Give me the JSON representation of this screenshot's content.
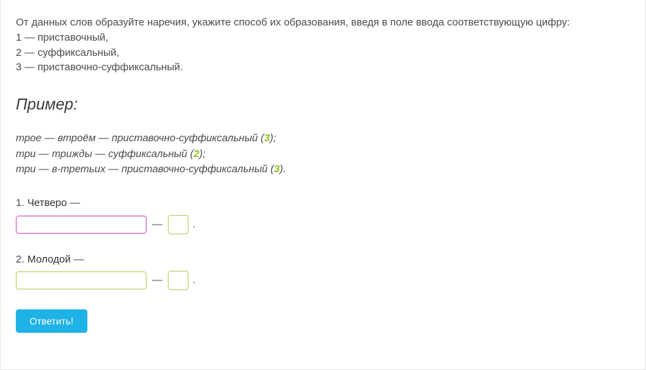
{
  "instructions": {
    "line1": "От данных слов образуйте наречия, укажите способ их образования, введя в поле ввода соответствующую цифру:",
    "opt1": "1 — приставочный,",
    "opt2": "2 — суффиксальный,",
    "opt3": "3 — приставочно-суффиксальный."
  },
  "example": {
    "heading": "Пример:",
    "lines": [
      {
        "pre": "трое — втроём — приставочно-суффиксальный (",
        "digit": "3",
        "post": ");"
      },
      {
        "pre": "три — трижды — суффиксальный (",
        "digit": "2",
        "post": ");"
      },
      {
        "pre": "три — в-третьих — приставочно-суффиксальный (",
        "digit": "3",
        "post": ")."
      }
    ]
  },
  "questions": [
    {
      "num": "1. ",
      "word": "Четверо",
      "tail": " —",
      "answer": "",
      "digit": ""
    },
    {
      "num": "2. ",
      "word": "Молодой",
      "tail": " —",
      "answer": "",
      "digit": ""
    }
  ],
  "submit_label": "Ответить!",
  "glyphs": {
    "dash": "—",
    "dot": "."
  }
}
